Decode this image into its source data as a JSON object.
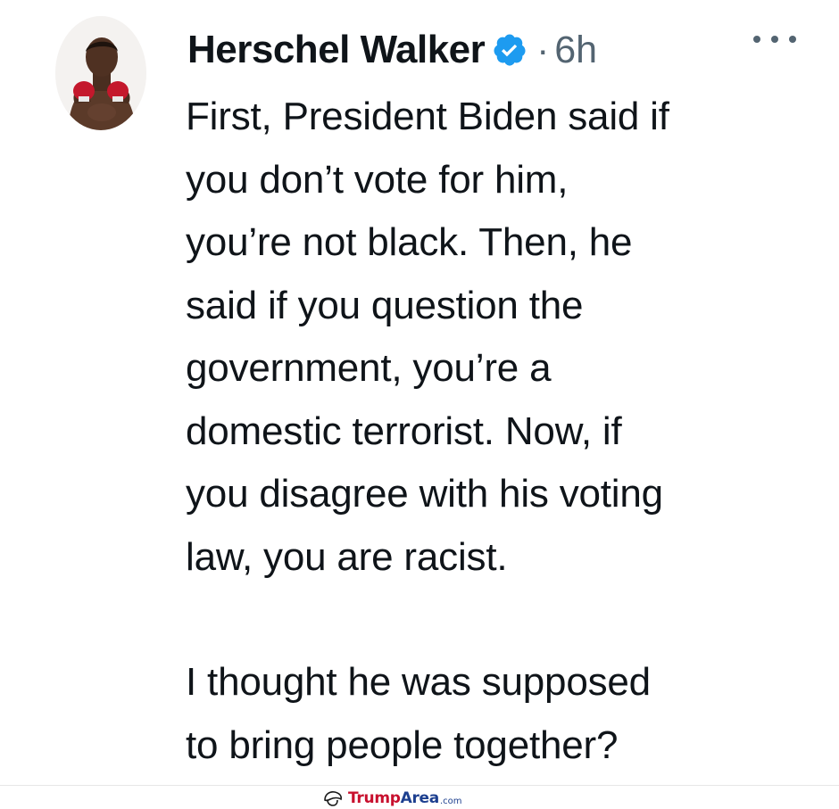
{
  "tweet": {
    "display_name": "Herschel Walker",
    "separator": "·",
    "time": "6h",
    "verified_icon": "verified-badge-icon",
    "more_icon": "more-options-icon",
    "lines": [
      "First, President Biden said if",
      "you don’t vote for him,",
      "you’re not black. Then, he",
      "said if you question the",
      "government, you’re a",
      "domestic terrorist. Now, if",
      "you disagree with his voting",
      "law, you are racist.",
      "",
      "I thought he was supposed",
      "to bring people together?"
    ],
    "colors": {
      "text": "#0f1419",
      "secondary": "#536471",
      "verified": "#1d9bf0"
    }
  },
  "watermark": {
    "part1": "Trump",
    "part2": "Area",
    "part3": ".com",
    "colors": {
      "trump": "#c8102e",
      "area": "#1d3f8f"
    }
  }
}
